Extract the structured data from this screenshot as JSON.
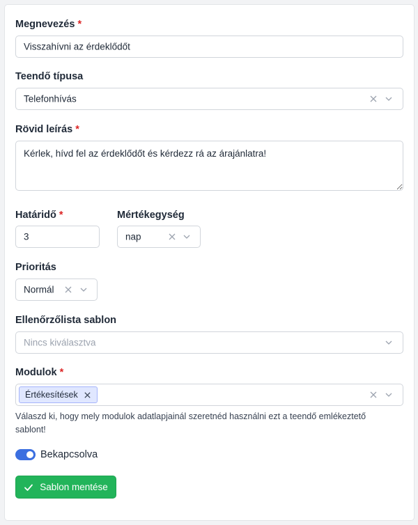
{
  "form": {
    "name": {
      "label": "Megnevezés",
      "required_mark": "*",
      "value": "Visszahívni az érdeklődőt"
    },
    "task_type": {
      "label": "Teendő típusa",
      "value": "Telefonhívás"
    },
    "short_desc": {
      "label": "Rövid leírás",
      "required_mark": "*",
      "value": "Kérlek, hívd fel az érdeklődőt és kérdezz rá az árajánlatra!"
    },
    "deadline": {
      "label": "Határidő",
      "required_mark": "*",
      "value": "3"
    },
    "unit": {
      "label": "Mértékegység",
      "value": "nap"
    },
    "priority": {
      "label": "Prioritás",
      "value": "Normál"
    },
    "checklist": {
      "label": "Ellenőrzőlista sablon",
      "placeholder": "Nincs kiválasztva"
    },
    "modules": {
      "label": "Modulok",
      "required_mark": "*",
      "tags": [
        "Értékesítések"
      ],
      "help": "Válaszd ki, hogy mely modulok adatlapjainál szeretnéd használni ezt a teendő emlékeztető sablont!"
    },
    "enabled": {
      "label": "Bekapcsolva",
      "on": true
    },
    "save_label": "Sablon mentése"
  },
  "colors": {
    "accent": "#3b6fe0",
    "success": "#22b45a",
    "required": "#dc2626",
    "tag_bg": "#e0e7ff"
  },
  "icons": {
    "clear": "x-icon",
    "dropdown": "chevron-down-icon",
    "save": "check-icon"
  }
}
